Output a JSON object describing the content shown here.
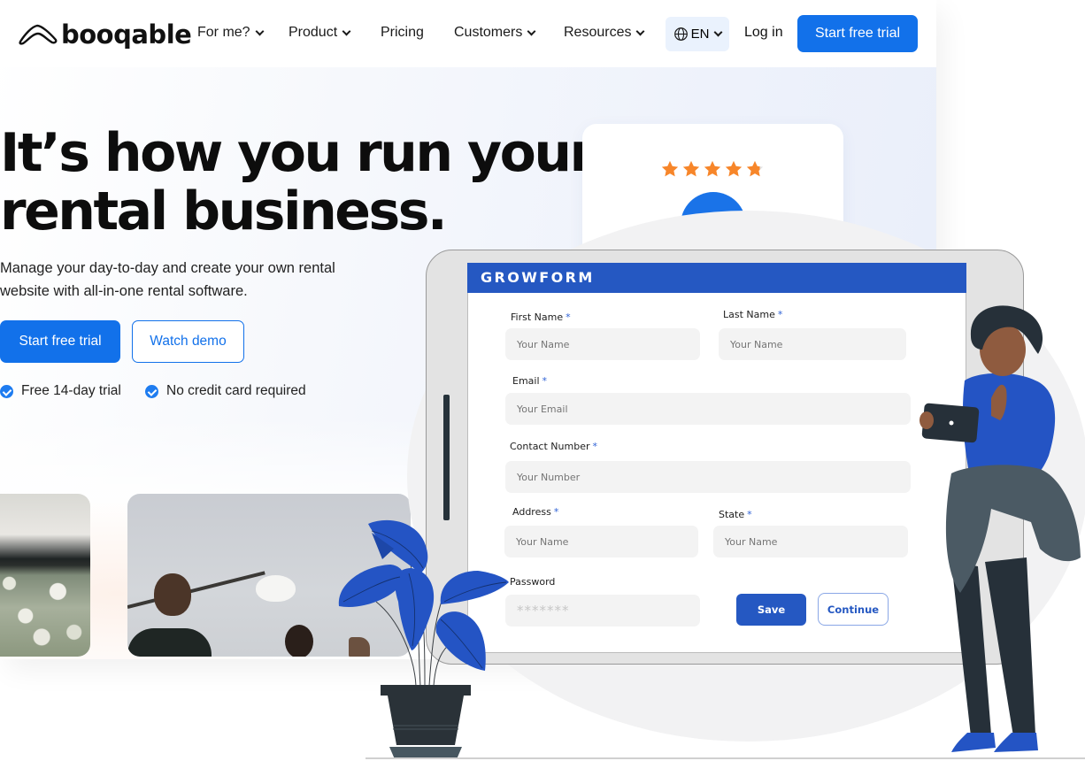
{
  "nav": {
    "brand": "booqable",
    "items": [
      {
        "label": "For me?",
        "has_dropdown": true
      },
      {
        "label": "Product",
        "has_dropdown": true
      },
      {
        "label": "Pricing",
        "has_dropdown": false
      },
      {
        "label": "Customers",
        "has_dropdown": true
      },
      {
        "label": "Resources",
        "has_dropdown": true
      }
    ],
    "language": "EN",
    "login": "Log in",
    "cta": "Start free trial"
  },
  "hero": {
    "title_line1": "It’s how you run your",
    "title_line2": "rental business.",
    "subtitle": "Manage your day-to-day and create your own rental website with all-in-one rental software.",
    "primary_button": "Start free trial",
    "secondary_button": "Watch demo",
    "checks": [
      "Free 14-day trial",
      "No credit card required"
    ]
  },
  "rating": {
    "value": "4.8",
    "stars": 4.8,
    "max_stars": 5
  },
  "form": {
    "title": "GROWFORM",
    "fields": {
      "first_name": {
        "label": "First Name",
        "required": "*",
        "placeholder": "Your Name"
      },
      "last_name": {
        "label": "Last Name",
        "required": "*",
        "placeholder": "Your Name"
      },
      "email": {
        "label": "Email",
        "required": "*",
        "placeholder": "Your Email"
      },
      "contact": {
        "label": "Contact  Number",
        "required": "*",
        "placeholder": "Your Number"
      },
      "address": {
        "label": "Address",
        "required": "*",
        "placeholder": "Your Name"
      },
      "state": {
        "label": "State",
        "required": "*",
        "placeholder": "Your Name"
      },
      "password": {
        "label": "Password",
        "placeholder": "*******"
      }
    },
    "save": "Save",
    "continue": "Continue"
  },
  "colors": {
    "brand_blue": "#1271ea",
    "form_blue": "#2558c2",
    "star_orange": "#f7862a",
    "text_dark": "#0d0d0d"
  }
}
